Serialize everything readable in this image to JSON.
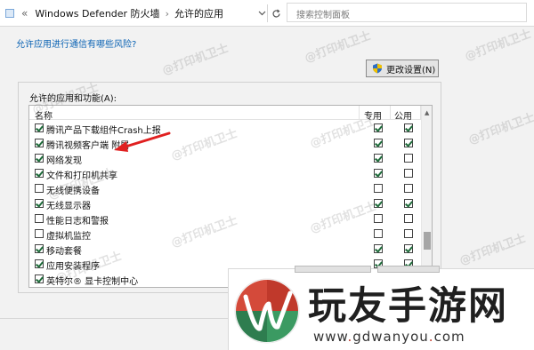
{
  "address_bar": {
    "crumbs": [
      "Windows Defender 防火墙",
      "允许的应用"
    ],
    "separator": "›",
    "double_chevron": "«",
    "search_placeholder": "搜索控制面板"
  },
  "content": {
    "risk_link": "允许应用进行通信有哪些风险?",
    "change_settings_button": "更改设置(N)",
    "group_label": "允许的应用和功能(A):",
    "columns": {
      "name": "名称",
      "private": "专用",
      "public": "公用"
    },
    "rows": [
      {
        "label": "腾讯产品下载组件Crash上报",
        "enabled": true,
        "private": true,
        "public": true
      },
      {
        "label": "腾讯视频客户端 附属",
        "enabled": true,
        "private": true,
        "public": true
      },
      {
        "label": "网络发现",
        "enabled": true,
        "private": true,
        "public": false
      },
      {
        "label": "文件和打印机共享",
        "enabled": true,
        "private": true,
        "public": false
      },
      {
        "label": "无线便携设备",
        "enabled": false,
        "private": false,
        "public": false
      },
      {
        "label": "无线显示器",
        "enabled": true,
        "private": true,
        "public": true
      },
      {
        "label": "性能日志和警报",
        "enabled": false,
        "private": false,
        "public": false
      },
      {
        "label": "虚拟机监控",
        "enabled": false,
        "private": false,
        "public": false
      },
      {
        "label": "移动套餐",
        "enabled": true,
        "private": true,
        "public": true
      },
      {
        "label": "应用安装程序",
        "enabled": true,
        "private": true,
        "public": true
      },
      {
        "label": "英特尔® 显卡控制中心",
        "enabled": true,
        "private": true,
        "public": true
      }
    ]
  },
  "watermark_text": "@打印机卫士",
  "brand": {
    "title": "玩友手游网",
    "url_parts": [
      "www",
      "gdwanyou",
      "com"
    ]
  },
  "colors": {
    "link": "#0b63b4",
    "arrow": "#e02020",
    "brand_red": "#c0392b",
    "brand_green": "#2e7d4f"
  }
}
